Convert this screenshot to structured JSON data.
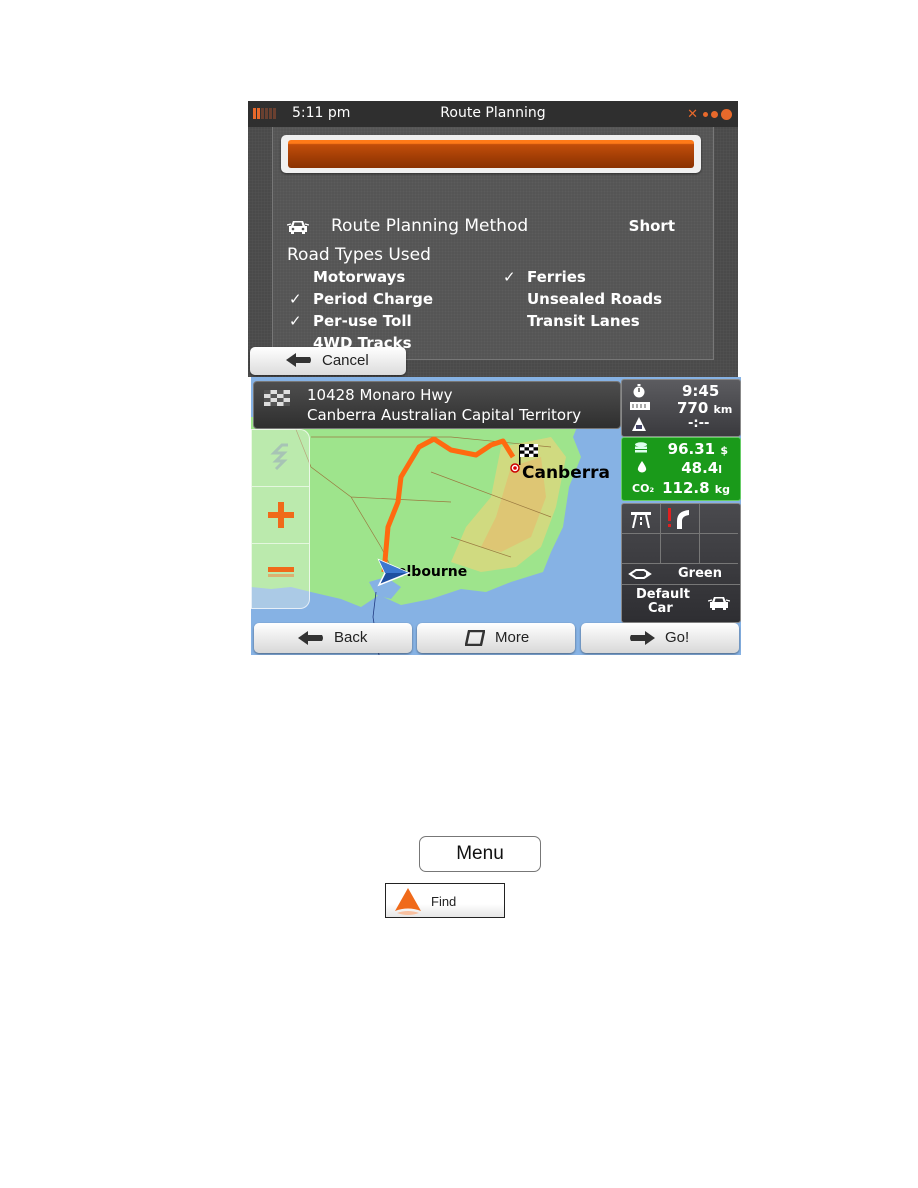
{
  "route_planning": {
    "status_bar": {
      "time": "5:11 pm",
      "title": "Route Planning",
      "battery_level": 0.4
    },
    "progress": {
      "fraction": 1.0
    },
    "method": {
      "label": "Route Planning Method",
      "value": "Short"
    },
    "road_types": {
      "label": "Road Types Used",
      "items": [
        {
          "label": "Motorways",
          "checked": false
        },
        {
          "label": "Period Charge",
          "checked": true
        },
        {
          "label": "Per-use Toll",
          "checked": true
        },
        {
          "label": "4WD Tracks",
          "checked": false
        },
        {
          "label": "Ferries",
          "checked": true
        },
        {
          "label": "Unsealed Roads",
          "checked": false
        },
        {
          "label": "Transit Lanes",
          "checked": false
        }
      ],
      "check_glyph": "✓"
    },
    "cancel_label": "Cancel"
  },
  "route_overview": {
    "destination": {
      "line1": "10428 Monaro Hwy",
      "line2": "Canberra Australian Capital Territory"
    },
    "map_labels": {
      "destination_city": "Canberra",
      "origin_city": "Melbourne",
      "origin_visible": "elbourne"
    },
    "trip": {
      "time": "9:45",
      "distance": "770",
      "distance_unit": "km",
      "delay": "-:--"
    },
    "eco": {
      "cost": "96.31",
      "cost_unit": "$",
      "fuel": "48.4",
      "fuel_unit": "l",
      "co2_label": "CO₂",
      "co2": "112.8",
      "co2_unit": "kg",
      "color": "#1a9a1a"
    },
    "method_short": "Green",
    "vehicle": {
      "line1": "Default",
      "line2": "Car"
    },
    "buttons": {
      "back": "Back",
      "more": "More",
      "go": "Go!"
    },
    "route_color": "#ff6a10"
  },
  "document": {
    "menu_label": "Menu",
    "find_label": "Find"
  }
}
